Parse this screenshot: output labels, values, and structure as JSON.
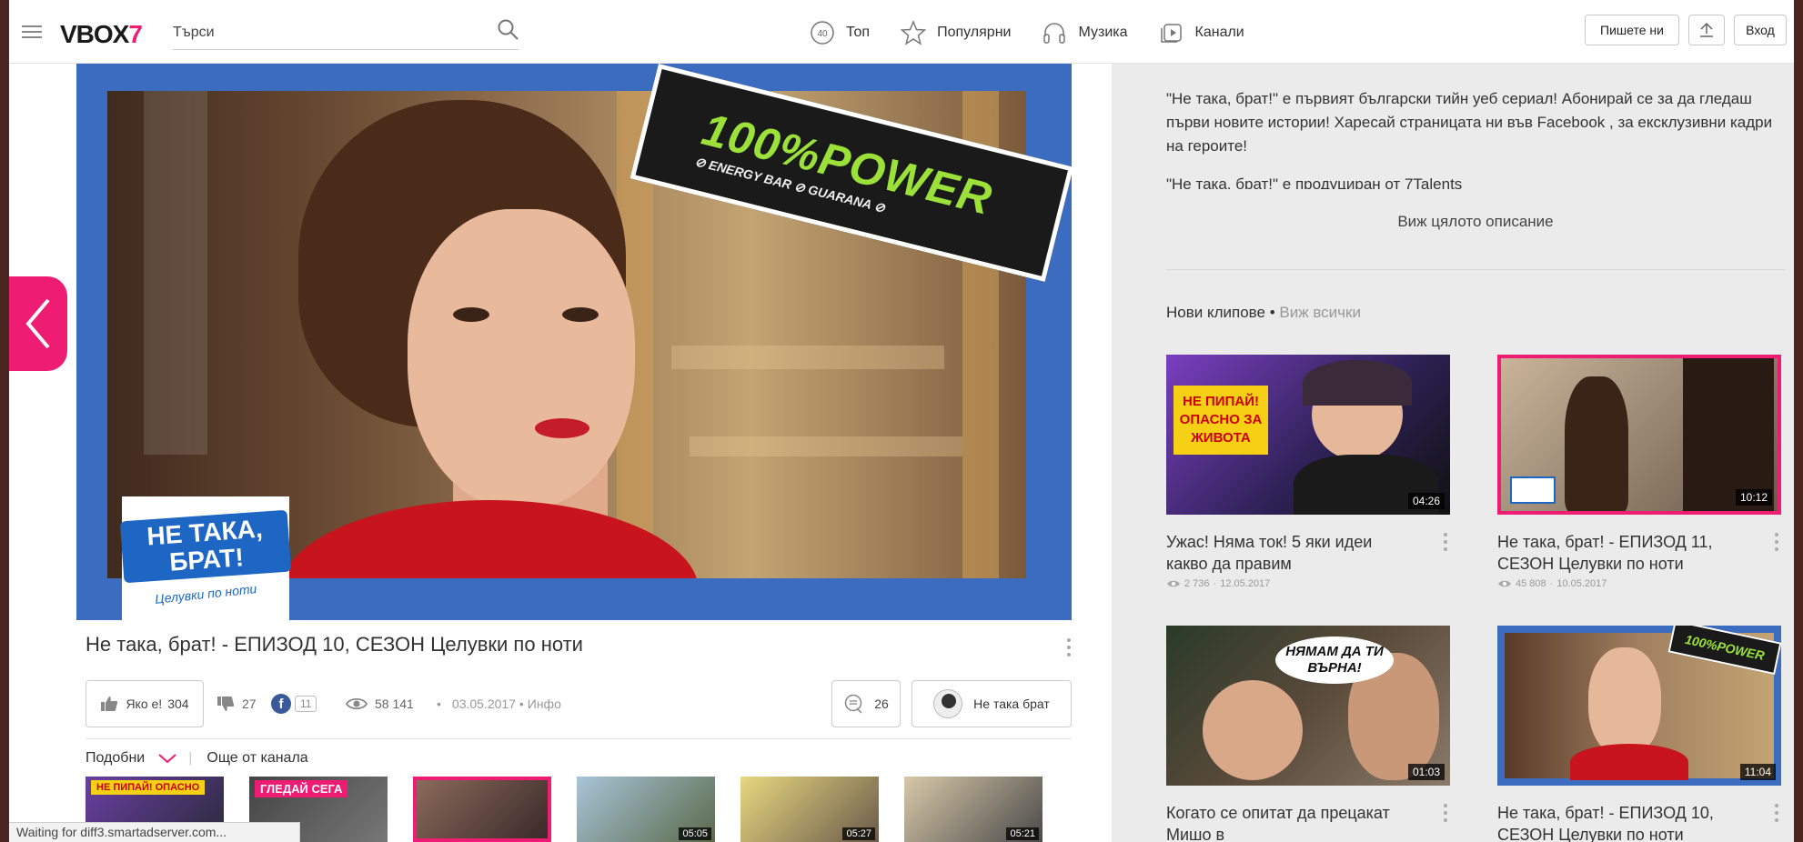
{
  "header": {
    "logo_main": "VBOX",
    "logo_accent": "7",
    "search_placeholder": "Търси",
    "nav": [
      {
        "label": "Топ",
        "badge": "40"
      },
      {
        "label": "Популярни"
      },
      {
        "label": "Музика"
      },
      {
        "label": "Канали"
      }
    ],
    "contact_label": "Пишете ни",
    "login_label": "Вход"
  },
  "player": {
    "energy_brand": "100%POWER",
    "energy_tag": "⊘ ENERGY BAR ⊘ GUARANA ⊘",
    "show_logo_main": "НЕ ТАКА, БРАТ!",
    "show_logo_sub": "Целувки по ноти"
  },
  "video": {
    "title": "Не така, брат! - ЕПИЗОД 10, СЕЗОН Целувки по ноти",
    "like_label": "Яко е!",
    "likes": "304",
    "dislikes": "27",
    "fb_shares": "11",
    "views": "58 141",
    "date": "03.05.2017 •",
    "info_label": "Инфо",
    "comments": "26",
    "channel_name": "Не така брат"
  },
  "related": {
    "tab_similar": "Подобни",
    "tab_channel": "Още от канала",
    "thumbs": [
      {
        "label": "НЕ ПИПАЙ! ОПАСНО",
        "duration": ""
      },
      {
        "label": "ГЛЕДАЙ СЕГА",
        "duration": ""
      },
      {
        "label": "",
        "duration": ""
      },
      {
        "label": "",
        "duration": "05:05"
      },
      {
        "label": "",
        "duration": "05:27"
      },
      {
        "label": "",
        "duration": "05:21"
      }
    ]
  },
  "sidebar": {
    "description": "\"Не така, брат!\" е първият български тийн уеб сериал! Абонирай се за да гледаш първи новите истории! Харесай страницата ни във Facebook , за ексклузивни кадри на героите!",
    "description_2": "\"Не така, брат!\" е продуциран от 7Talents",
    "see_full": "Виж цялото описание",
    "new_clips_label": "Нови клипове •",
    "see_all": "Виж всички",
    "clips": [
      {
        "title": "Ужас! Няма ток! 5 яки идеи какво да правим",
        "views": "2 736",
        "date": "12.05.2017",
        "duration": "04:26",
        "thumb_text": "НЕ ПИПАЙ! ОПАСНО ЗА ЖИВОТА"
      },
      {
        "title": "Не така, брат! - ЕПИЗОД 11, СЕЗОН Целувки по ноти",
        "views": "45 808",
        "date": "10.05.2017",
        "duration": "10:12",
        "thumb_text": ""
      },
      {
        "title": "Когато се опитат да прецакат Мишо в",
        "views": "",
        "date": "",
        "duration": "01:03",
        "thumb_text": "НЯМАМ ДА ТИ ВЪРНА!"
      },
      {
        "title": "Не така, брат! - ЕПИЗОД 10, СЕЗОН Целувки по ноти",
        "views": "",
        "date": "",
        "duration": "11:04",
        "thumb_text": "100%POWER"
      }
    ]
  },
  "status_bar": "Waiting for diff3.smartadserver.com...",
  "colors": {
    "accent": "#ee1c72",
    "player_frame": "#3b6cbf",
    "sidebar_bg": "#ebebeb"
  }
}
